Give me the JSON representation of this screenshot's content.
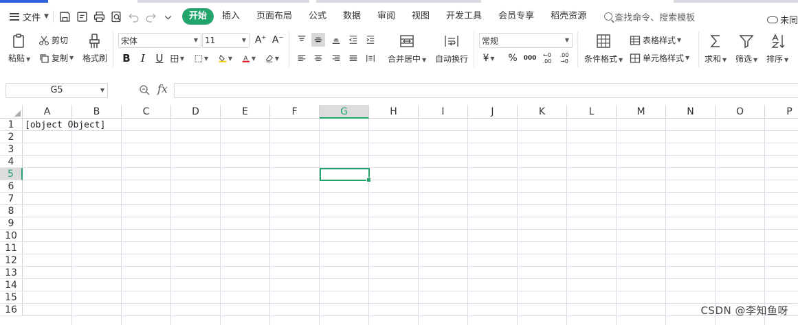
{
  "menubar": {
    "file_label": "文件",
    "tabs": [
      "开始",
      "插入",
      "页面布局",
      "公式",
      "数据",
      "审阅",
      "视图",
      "开发工具",
      "会员专享",
      "稻壳资源"
    ],
    "active_tab": "开始",
    "search_placeholder": "查找命令、搜索模板",
    "sync_status": "未同"
  },
  "ribbon": {
    "paste": "粘贴",
    "cut": "剪切",
    "copy": "复制",
    "format_painter": "格式刷",
    "font_name": "宋体",
    "font_size": "11",
    "number_format": "常规",
    "merge_center": "合并居中",
    "wrap_text": "自动换行",
    "conditional_format": "条件格式",
    "table_style": "表格样式",
    "cell_style": "单元格样式",
    "sum": "求和",
    "filter": "筛选",
    "sort": "排序",
    "currency_symbol": "¥",
    "percent_symbol": "%",
    "thousands_symbol": "000"
  },
  "formula_bar": {
    "name_box": "G5",
    "fx_label": "fx",
    "formula": ""
  },
  "sheet": {
    "columns": [
      "A",
      "B",
      "C",
      "D",
      "E",
      "F",
      "G",
      "H",
      "I",
      "J",
      "K",
      "L",
      "M",
      "N",
      "O",
      "P"
    ],
    "rows": [
      "1",
      "2",
      "3",
      "4",
      "5",
      "6",
      "7",
      "8",
      "9",
      "10",
      "11",
      "12",
      "13",
      "14",
      "15",
      "16"
    ],
    "selected_column": "G",
    "selected_row": "5",
    "cell_A1": "[object Object]"
  },
  "watermark": "CSDN @李知鱼呀",
  "colors": {
    "accent": "#22a56c",
    "header_selected_bg": "#dcdcdc",
    "gridline": "#dadce7"
  }
}
